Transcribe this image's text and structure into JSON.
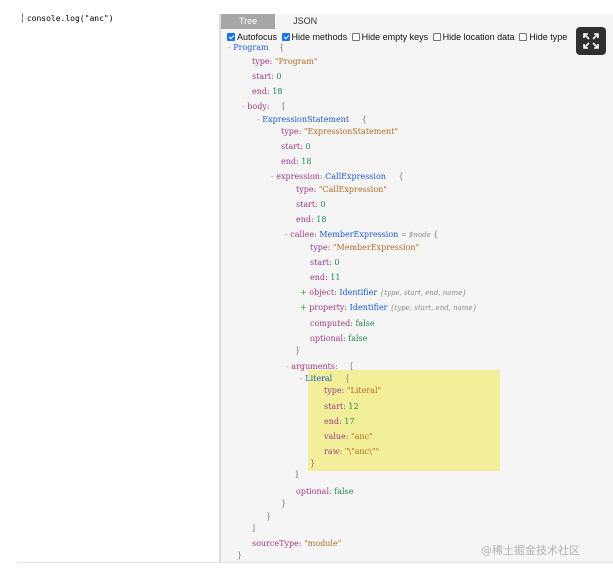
{
  "editor": {
    "code": "console.log(\"anc\")"
  },
  "tabs": [
    "Tree",
    "JSON"
  ],
  "options": [
    {
      "label": "Autofocus",
      "checked": true
    },
    {
      "label": "Hide methods",
      "checked": true
    },
    {
      "label": "Hide empty keys",
      "checked": false
    },
    {
      "label": "Hide location data",
      "checked": false
    },
    {
      "label": "Hide type",
      "checked": false
    }
  ],
  "tree": {
    "program": {
      "toggle": "-",
      "name": "Program",
      "brace": "{"
    },
    "program_type": {
      "key": "type:",
      "value": "\"Program\""
    },
    "program_start": {
      "key": "start:",
      "value": "0"
    },
    "program_end": {
      "key": "end:",
      "value": "18"
    },
    "body": {
      "toggle": "-",
      "key": "body:",
      "brace": "["
    },
    "expr_stmt": {
      "toggle": "-",
      "name": "ExpressionStatement",
      "brace": "{"
    },
    "es_type": {
      "key": "type:",
      "value": "\"ExpressionStatement\""
    },
    "es_start": {
      "key": "start:",
      "value": "0"
    },
    "es_end": {
      "key": "end:",
      "value": "18"
    },
    "expression": {
      "toggle": "-",
      "key": "expression:",
      "name": "CallExpression",
      "brace": "{"
    },
    "ce_type": {
      "key": "type:",
      "value": "\"CallExpression\""
    },
    "ce_start": {
      "key": "start:",
      "value": "0"
    },
    "ce_end": {
      "key": "end:",
      "value": "18"
    },
    "callee": {
      "toggle": "-",
      "key": "callee:",
      "name": "MemberExpression",
      "hint": "= $node",
      "brace": "{"
    },
    "me_type": {
      "key": "type:",
      "value": "\"MemberExpression\""
    },
    "me_start": {
      "key": "start:",
      "value": "0"
    },
    "me_end": {
      "key": "end:",
      "value": "11"
    },
    "object": {
      "toggle": "+",
      "key": "object:",
      "name": "Identifier",
      "hint": "{type, start, end, name}"
    },
    "property": {
      "toggle": "+",
      "key": "property:",
      "name": "Identifier",
      "hint": "{type, start, end, name}"
    },
    "computed": {
      "key": "computed:",
      "value": "false"
    },
    "optional1": {
      "key": "optional:",
      "value": "false"
    },
    "close1": "}",
    "arguments": {
      "toggle": "-",
      "key": "arguments:",
      "brace": "["
    },
    "literal": {
      "toggle": "-",
      "name": "Literal",
      "brace": "{"
    },
    "lit_type": {
      "key": "type:",
      "value": "\"Literal\""
    },
    "lit_start": {
      "key": "start:",
      "value": "12"
    },
    "lit_end": {
      "key": "end:",
      "value": "17"
    },
    "lit_value": {
      "key": "value:",
      "value": "\"anc\""
    },
    "lit_raw": {
      "key": "raw:",
      "value": "\"\\\"anc\\\"\""
    },
    "close2": "}",
    "close3": "]",
    "optional2": {
      "key": "optional:",
      "value": "false"
    },
    "close4": "}",
    "close5": "}",
    "close6": "]",
    "sourcetype": {
      "key": "sourceType:",
      "value": "\"module\""
    },
    "close7": "}"
  },
  "watermark": "@稀土掘金技术社区"
}
